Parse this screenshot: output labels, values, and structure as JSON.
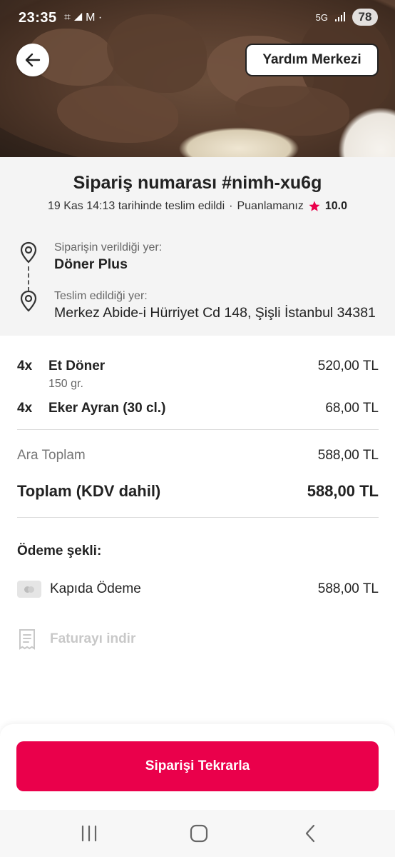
{
  "status_bar": {
    "time": "23:35",
    "left_icons": "⌗ ◢ M ·",
    "network": "5G",
    "battery": "78"
  },
  "header": {
    "help_label": "Yardım Merkezi"
  },
  "order": {
    "title": "Sipariş numarası #nimh-xu6g",
    "delivered_text": "19 Kas 14:13 tarihinde teslim edildi",
    "separator": "·",
    "rating_label": "Puanlamanız",
    "rating_value": "10.0"
  },
  "pickup": {
    "label": "Siparişin verildiği yer:",
    "value": "Döner Plus"
  },
  "dropoff": {
    "label": "Teslim edildiği yer:",
    "value": "Merkez Abide-i Hürriyet Cd 148, Şişli İstanbul 34381"
  },
  "items": [
    {
      "qty": "4x",
      "name": "Et Döner",
      "note": "150 gr.",
      "price": "520,00 TL"
    },
    {
      "qty": "4x",
      "name": "Eker Ayran (30 cl.)",
      "note": "",
      "price": "68,00 TL"
    }
  ],
  "summary": {
    "subtotal_label": "Ara Toplam",
    "subtotal_value": "588,00 TL",
    "total_label": "Toplam (KDV dahil)",
    "total_value": "588,00 TL"
  },
  "payment": {
    "title": "Ödeme şekli:",
    "method": "Kapıda Ödeme",
    "amount": "588,00 TL"
  },
  "invoice": {
    "label": "Faturayı indir"
  },
  "cta": {
    "label": "Siparişi Tekrarla"
  },
  "colors": {
    "accent": "#ea004b",
    "info_bg": "#f4f4f4",
    "muted": "#777777"
  },
  "icons": [
    "arrow-left-icon",
    "star-icon",
    "map-pin-icon",
    "card-icon",
    "receipt-icon",
    "nav-recents-icon",
    "nav-home-icon",
    "nav-back-icon"
  ]
}
